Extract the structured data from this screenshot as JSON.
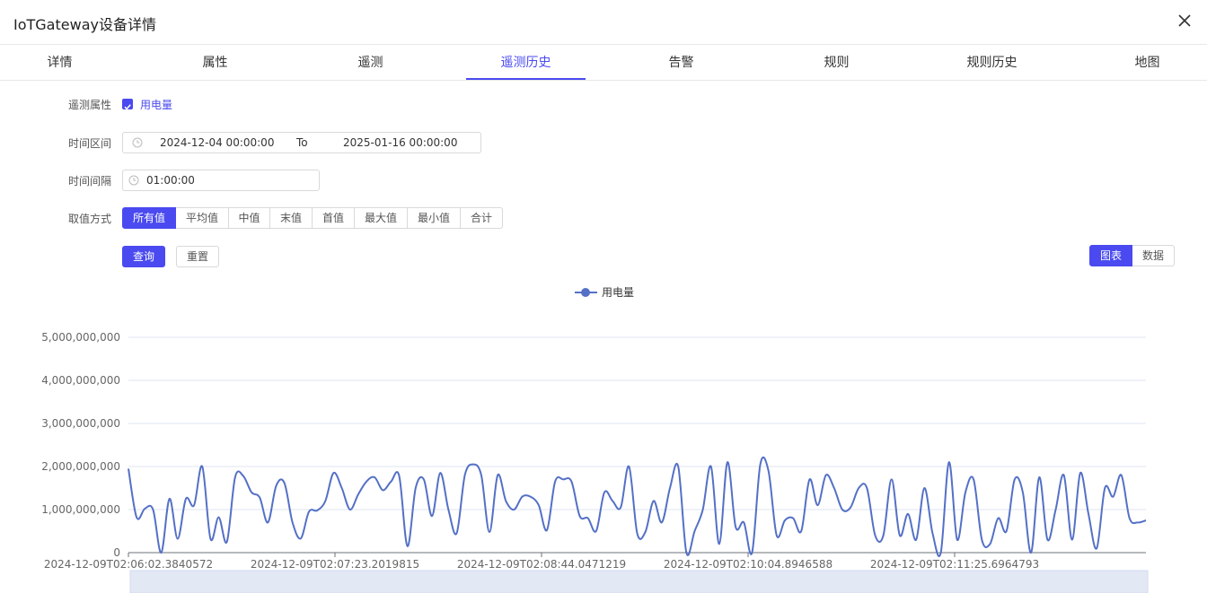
{
  "dialog": {
    "title": "IoTGateway设备详情"
  },
  "tabs": [
    {
      "label": "详情"
    },
    {
      "label": "属性"
    },
    {
      "label": "遥测"
    },
    {
      "label": "遥测历史"
    },
    {
      "label": "告警"
    },
    {
      "label": "规则"
    },
    {
      "label": "规则历史"
    },
    {
      "label": "地图"
    }
  ],
  "active_tab": "遥测历史",
  "form": {
    "property_label": "遥测属性",
    "property_option": "用电量",
    "range_label": "时间区间",
    "range_start": "2024-12-04 00:00:00",
    "range_sep": "To",
    "range_end": "2025-01-16 00:00:00",
    "interval_label": "时间间隔",
    "interval_value": "01:00:00",
    "agg_label": "取值方式",
    "agg_options": [
      "所有值",
      "平均值",
      "中值",
      "末值",
      "首值",
      "最大值",
      "最小值",
      "合计"
    ],
    "agg_selected": "所有值"
  },
  "actions": {
    "query": "查询",
    "reset": "重置"
  },
  "view_toggle": {
    "chart": "图表",
    "data": "数据",
    "selected": "图表"
  },
  "colors": {
    "accent": "#4a4af0",
    "series": "#5470c6"
  },
  "chart_data": {
    "type": "line",
    "title": "",
    "ylim": [
      0,
      5000000000
    ],
    "y_ticks": [
      "0",
      "1,000,000,000",
      "2,000,000,000",
      "3,000,000,000",
      "4,000,000,000",
      "5,000,000,000"
    ],
    "x_ticks": [
      "2024-12-09T02:06:02.3840572",
      "2024-12-09T02:07:23.2019815",
      "2024-12-09T02:08:44.0471219",
      "2024-12-09T02:10:04.8946588",
      "2024-12-09T02:11:25.6964793"
    ],
    "grid": true,
    "legend": "top-center",
    "series": [
      {
        "name": "用电量",
        "values": [
          1950000000,
          820000000,
          1020000000,
          1000000000,
          0,
          1250000000,
          320000000,
          1250000000,
          1100000000,
          2000000000,
          320000000,
          820000000,
          250000000,
          1750000000,
          1780000000,
          1400000000,
          1280000000,
          700000000,
          1550000000,
          1620000000,
          700000000,
          330000000,
          950000000,
          980000000,
          1200000000,
          1850000000,
          1500000000,
          1000000000,
          1350000000,
          1650000000,
          1750000000,
          1450000000,
          1650000000,
          1780000000,
          150000000,
          1500000000,
          1700000000,
          850000000,
          1850000000,
          1000000000,
          450000000,
          1800000000,
          2050000000,
          1800000000,
          480000000,
          1800000000,
          1200000000,
          1000000000,
          1300000000,
          1300000000,
          1100000000,
          520000000,
          1650000000,
          1700000000,
          1650000000,
          850000000,
          800000000,
          500000000,
          1400000000,
          1200000000,
          1050000000,
          2000000000,
          450000000,
          480000000,
          1200000000,
          700000000,
          1500000000,
          2000000000,
          0,
          500000000,
          1000000000,
          2000000000,
          200000000,
          2100000000,
          600000000,
          700000000,
          0,
          2050000000,
          1900000000,
          400000000,
          750000000,
          800000000,
          500000000,
          1700000000,
          1100000000,
          1800000000,
          1500000000,
          1000000000,
          1050000000,
          1500000000,
          1500000000,
          400000000,
          400000000,
          1700000000,
          400000000,
          900000000,
          300000000,
          1500000000,
          450000000,
          0,
          2100000000,
          300000000,
          1400000000,
          1700000000,
          300000000,
          200000000,
          800000000,
          500000000,
          1700000000,
          1400000000,
          0,
          1750000000,
          300000000,
          1000000000,
          1800000000,
          300000000,
          1850000000,
          900000000,
          100000000,
          1500000000,
          1300000000,
          1800000000,
          800000000,
          700000000,
          750000000
        ]
      }
    ]
  }
}
